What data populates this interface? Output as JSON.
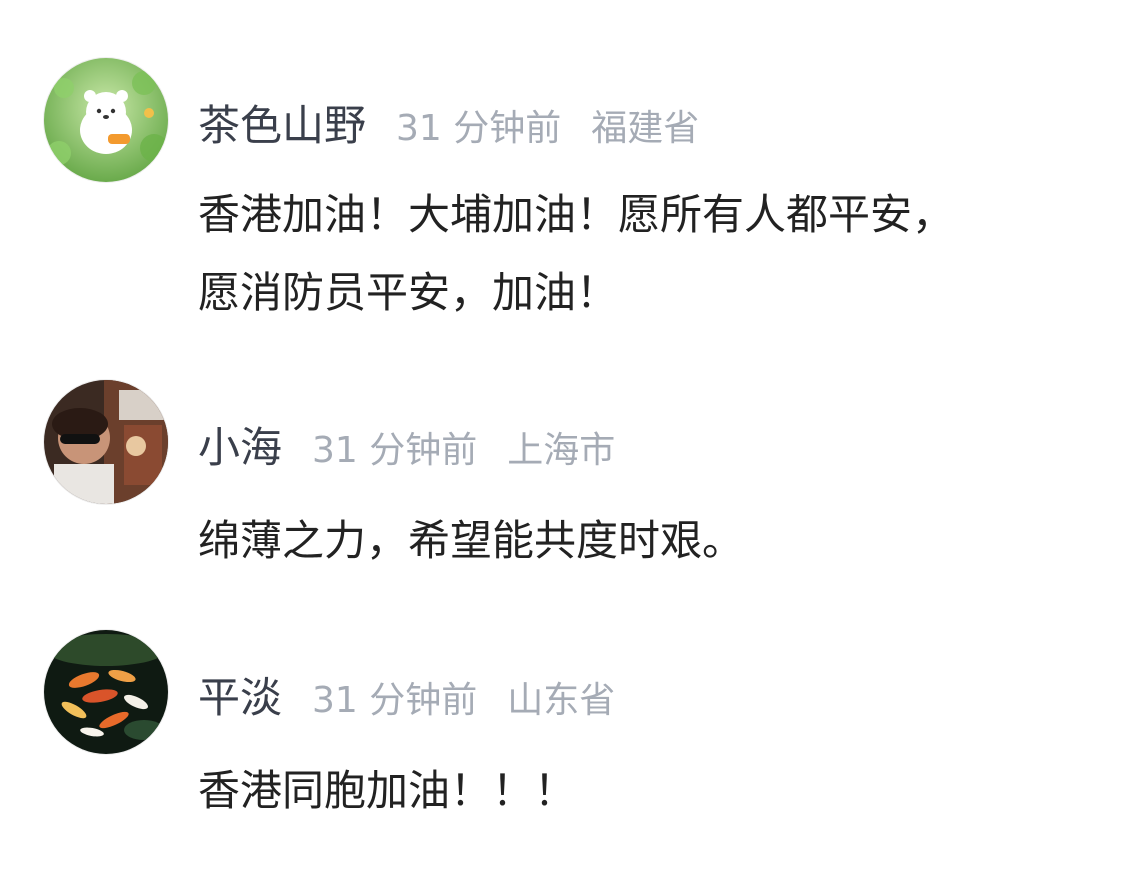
{
  "comments": [
    {
      "username": "茶色山野",
      "time": "31 分钟前",
      "location": "福建省",
      "lines": [
        "香港加油！大埔加油！愿所有人都平安，",
        "愿消防员平安，加油！"
      ],
      "avatar_icon": "cartoon-bear-avatar"
    },
    {
      "username": "小海",
      "time": "31 分钟前",
      "location": "上海市",
      "lines": [
        "绵薄之力，希望能共度时艰。"
      ],
      "avatar_icon": "person-in-car-avatar"
    },
    {
      "username": "平淡",
      "time": "31 分钟前",
      "location": "山东省",
      "lines": [
        "香港同胞加油！！！"
      ],
      "avatar_icon": "koi-fish-avatar"
    }
  ],
  "colors": {
    "username": "#3a3f4b",
    "meta": "#a5abb5",
    "text": "#222222",
    "background": "#ffffff"
  }
}
